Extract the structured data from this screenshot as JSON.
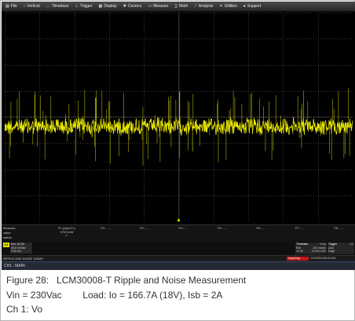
{
  "menu": [
    {
      "label": "File",
      "icon": "file-icon"
    },
    {
      "label": "Vertical",
      "icon": "vertical-icon"
    },
    {
      "label": "Timebase",
      "icon": "timebase-icon"
    },
    {
      "label": "Trigger",
      "icon": "trigger-icon"
    },
    {
      "label": "Display",
      "icon": "display-icon"
    },
    {
      "label": "Cursors",
      "icon": "cursors-icon"
    },
    {
      "label": "Measure",
      "icon": "measure-icon"
    },
    {
      "label": "Math",
      "icon": "math-icon"
    },
    {
      "label": "Analysis",
      "icon": "analysis-icon"
    },
    {
      "label": "Utilities",
      "icon": "utilities-icon"
    },
    {
      "label": "Support",
      "icon": "support-icon"
    }
  ],
  "colors": {
    "trace": "#e6e600",
    "grid": "#3a3a3a",
    "grid_dots": "#555555",
    "acquiring": "#c01818",
    "check": "#39d039"
  },
  "measure": {
    "label_measure": "Measure",
    "label_value": "value",
    "label_status": "status",
    "columns": [
      {
        "name": "P1:pkpk(C1)",
        "value": "170.9 mV",
        "status": "✓"
      },
      {
        "name": "P2:- - -",
        "value": "",
        "status": ""
      },
      {
        "name": "P3:- - -",
        "value": "",
        "status": ""
      },
      {
        "name": "P4:- - -",
        "value": "",
        "status": ""
      },
      {
        "name": "P5:- - -",
        "value": "",
        "status": ""
      },
      {
        "name": "P6:- - -",
        "value": "",
        "status": ""
      },
      {
        "name": "P7:- - -",
        "value": "",
        "status": ""
      },
      {
        "name": "P8:- - -",
        "value": "",
        "status": ""
      }
    ]
  },
  "channel": {
    "badge": "C1",
    "coupling": "BwL AC1M",
    "scale": "50.0 mV/div",
    "offset": "0.00 mV"
  },
  "timebase": {
    "title": "Timebase",
    "delay": "0 ms",
    "mode": "Roll",
    "per_div": "100 ms/div",
    "samples": "10 kS",
    "rate": "10.000 kS/s"
  },
  "trigger": {
    "title": "Trigger",
    "channel": "C1",
    "mode": "Auto",
    "type": "Edge"
  },
  "status": {
    "left": "RIPPLE AND NOISE 100MS",
    "acq": "Acquiring",
    "datetime": "1/1/2009 6:50:34 AM"
  },
  "tab": {
    "label": "CH1 : MAIN"
  },
  "caption": {
    "line1": "Figure 28:   LCM30008-T Ripple and Noise Measurement",
    "line2": "Vin = 230Vac        Load: Io = 166.7A (18V), Isb = 2A",
    "line3": "Ch 1: Vo"
  }
}
